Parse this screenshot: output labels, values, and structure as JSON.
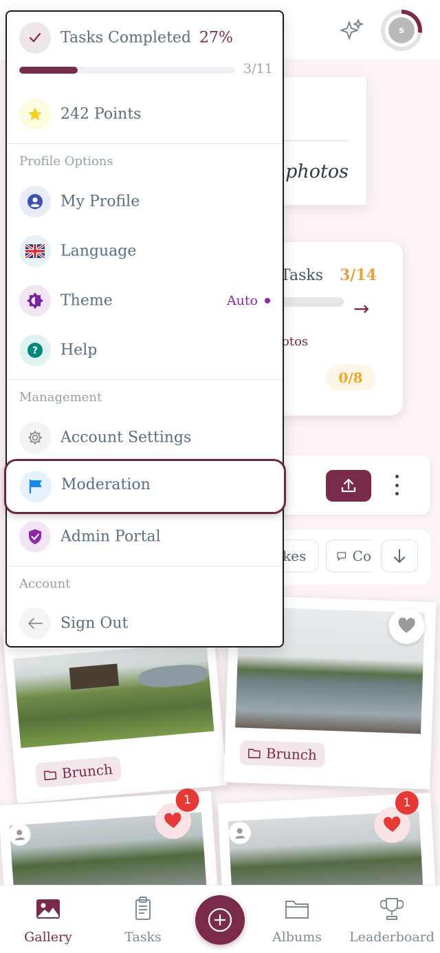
{
  "header": {
    "avatar_initial": "s"
  },
  "background": {
    "card_text": "f photos",
    "tasks_label": "Tasks",
    "tasks_count": "3/14",
    "photos_label": "otos",
    "photos_count": "0/8",
    "chip_likes": "kes",
    "chip_comments": "Co"
  },
  "gallery": [
    {
      "tag": "Brunch"
    },
    {
      "tag": "Brunch"
    },
    {
      "likes": "1"
    },
    {
      "likes": "1"
    }
  ],
  "menu": {
    "tasks_completed": {
      "label": "Tasks Completed",
      "percent": "27%",
      "count": "3/11",
      "progress": 0.27
    },
    "points": {
      "label": "242 Points"
    },
    "profile_section": "Profile Options",
    "my_profile": "My Profile",
    "language": "Language",
    "theme": {
      "label": "Theme",
      "value": "Auto"
    },
    "help": "Help",
    "management_section": "Management",
    "account_settings": "Account Settings",
    "moderation": "Moderation",
    "admin_portal": "Admin Portal",
    "account_section": "Account",
    "sign_out": "Sign Out"
  },
  "bottom_nav": {
    "gallery": "Gallery",
    "tasks": "Tasks",
    "albums": "Albums",
    "leaderboard": "Leaderboard"
  },
  "colors": {
    "brand": "#7a2a4a",
    "accent_orange": "#e6a23a",
    "theme_purple": "#8e24aa",
    "heart_red": "#e53935"
  },
  "icons": [
    "check-icon",
    "star-icon",
    "user-icon",
    "uk-flag-icon",
    "theme-icon",
    "help-icon",
    "gear-icon",
    "flag-icon",
    "shield-check-icon",
    "arrow-left-icon",
    "sparkle-icon",
    "upload-icon",
    "more-vert-icon",
    "heart-icon",
    "image-icon",
    "clipboard-icon",
    "plus-icon",
    "folder-icon",
    "trophy-icon",
    "comment-icon",
    "sort-down-icon"
  ]
}
